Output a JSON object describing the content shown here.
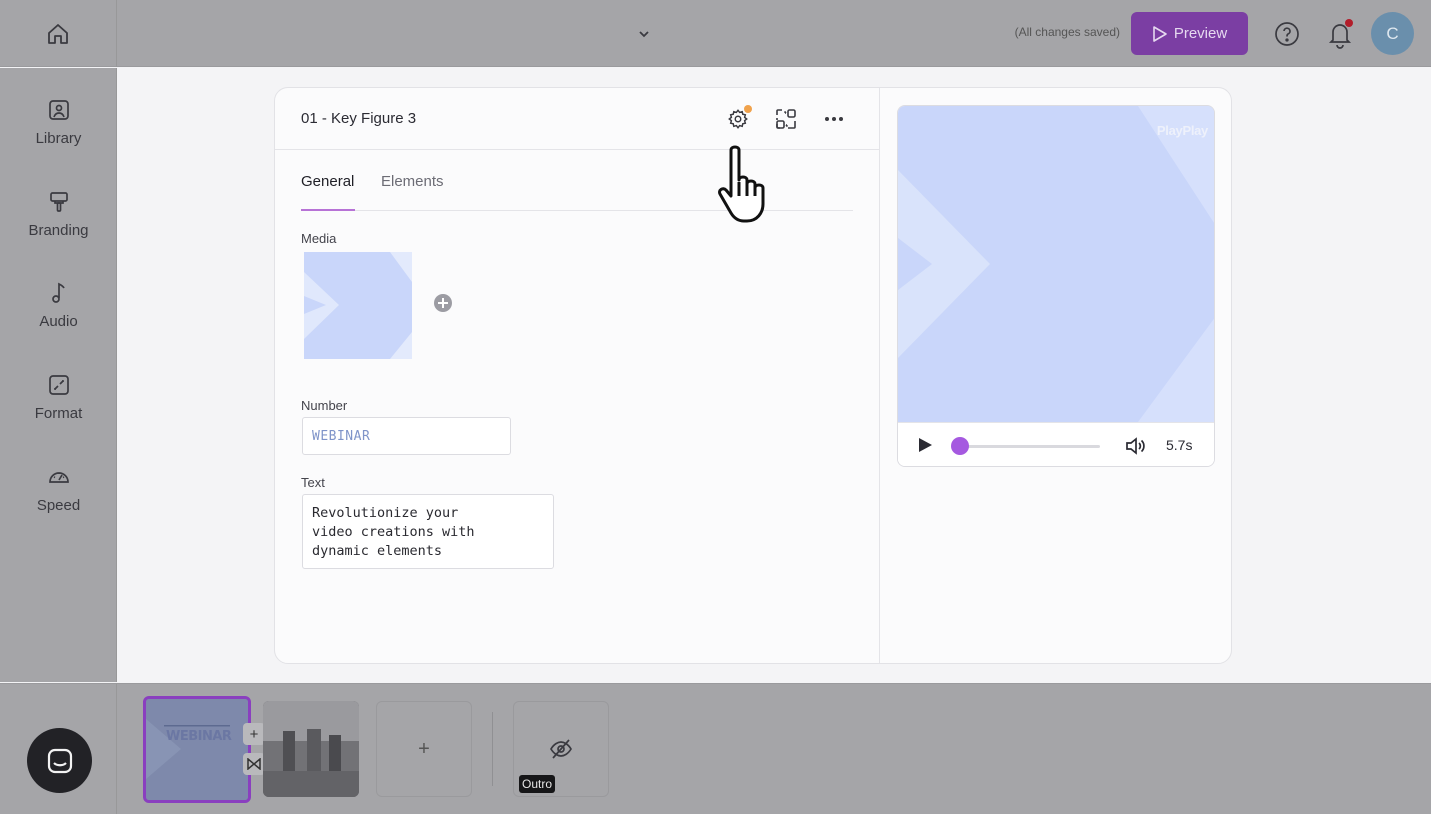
{
  "topbar": {
    "home_icon": "home-icon",
    "project_dropdown_icon": "chevron-down-icon",
    "save_status": "(All changes saved)",
    "preview_label": "Preview",
    "help_icon": "help-circle-icon",
    "notifications_icon": "bell-icon",
    "avatar_initial": "C",
    "accent_color": "#7b3ea3"
  },
  "sidebar": {
    "items": [
      {
        "label": "Library",
        "icon": "image-icon"
      },
      {
        "label": "Branding",
        "icon": "paint-roller-icon"
      },
      {
        "label": "Audio",
        "icon": "music-note-icon"
      },
      {
        "label": "Format",
        "icon": "resize-icon"
      },
      {
        "label": "Speed",
        "icon": "gauge-icon"
      }
    ]
  },
  "editor": {
    "scene_title": "01 - Key Figure 3",
    "header_icons": [
      "gear-icon",
      "swap-layout-icon",
      "more-icon"
    ],
    "tabs": [
      {
        "label": "General",
        "active": true
      },
      {
        "label": "Elements",
        "active": false
      }
    ],
    "media_label": "Media",
    "number_label": "Number",
    "number_value": "WEBINAR",
    "text_label": "Text",
    "text_value": "Revolutionize your\nvideo creations with\ndynamic elements"
  },
  "preview": {
    "brand_watermark": "PlayPlay",
    "duration": "5.7s",
    "progress": 0.0,
    "accent_color": "#a559e0"
  },
  "timeline": {
    "clip_1_label": "WEBINAR",
    "add_label": "+",
    "outro_label": "Outro"
  }
}
